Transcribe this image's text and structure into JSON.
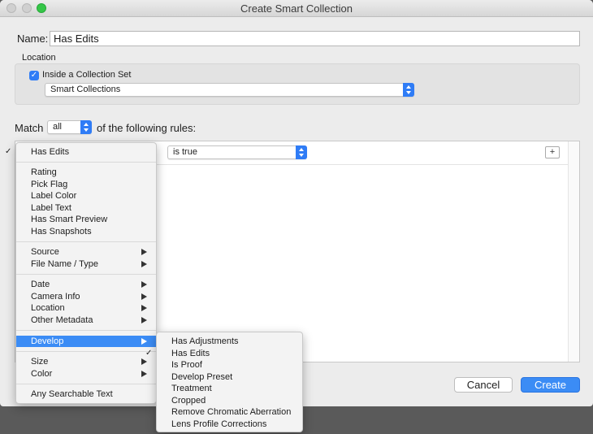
{
  "window": {
    "title": "Create Smart Collection"
  },
  "name": {
    "label": "Name:",
    "value": "Has Edits"
  },
  "location": {
    "label": "Location",
    "inside_set_label": "Inside a Collection Set",
    "inside_set_checked": true,
    "collection_set": "Smart Collections"
  },
  "match": {
    "label": "Match",
    "mode": "all",
    "suffix": "of the following rules:"
  },
  "rule": {
    "field": "Has Edits",
    "condition": "is true",
    "add_symbol": "+"
  },
  "buttons": {
    "cancel": "Cancel",
    "create": "Create"
  },
  "field_menu": {
    "selected": "Has Edits",
    "items": [
      {
        "label": "Has Edits",
        "checked": true
      },
      {
        "label": "Rating"
      },
      {
        "label": "Pick Flag"
      },
      {
        "label": "Label Color"
      },
      {
        "label": "Label Text"
      },
      {
        "label": "Has Smart Preview"
      },
      {
        "label": "Has Snapshots"
      },
      {
        "label": "Source",
        "submenu": true
      },
      {
        "label": "File Name / Type",
        "submenu": true
      },
      {
        "label": "Date",
        "submenu": true
      },
      {
        "label": "Camera Info",
        "submenu": true
      },
      {
        "label": "Location",
        "submenu": true
      },
      {
        "label": "Other Metadata",
        "submenu": true
      },
      {
        "label": "Develop",
        "submenu": true,
        "highlighted": true
      },
      {
        "label": "Size",
        "submenu": true
      },
      {
        "label": "Color",
        "submenu": true
      },
      {
        "label": "Any Searchable Text"
      }
    ]
  },
  "develop_menu": {
    "items": [
      {
        "label": "Has Adjustments"
      },
      {
        "label": "Has Edits",
        "checked": true
      },
      {
        "label": "Is Proof"
      },
      {
        "label": "Develop Preset"
      },
      {
        "label": "Treatment"
      },
      {
        "label": "Cropped"
      },
      {
        "label": "Remove Chromatic Aberration"
      },
      {
        "label": "Lens Profile Corrections"
      }
    ]
  },
  "colors": {
    "accent": "#3b8cf5",
    "window_bg": "#ececec",
    "zoom_button": "#35c648"
  }
}
